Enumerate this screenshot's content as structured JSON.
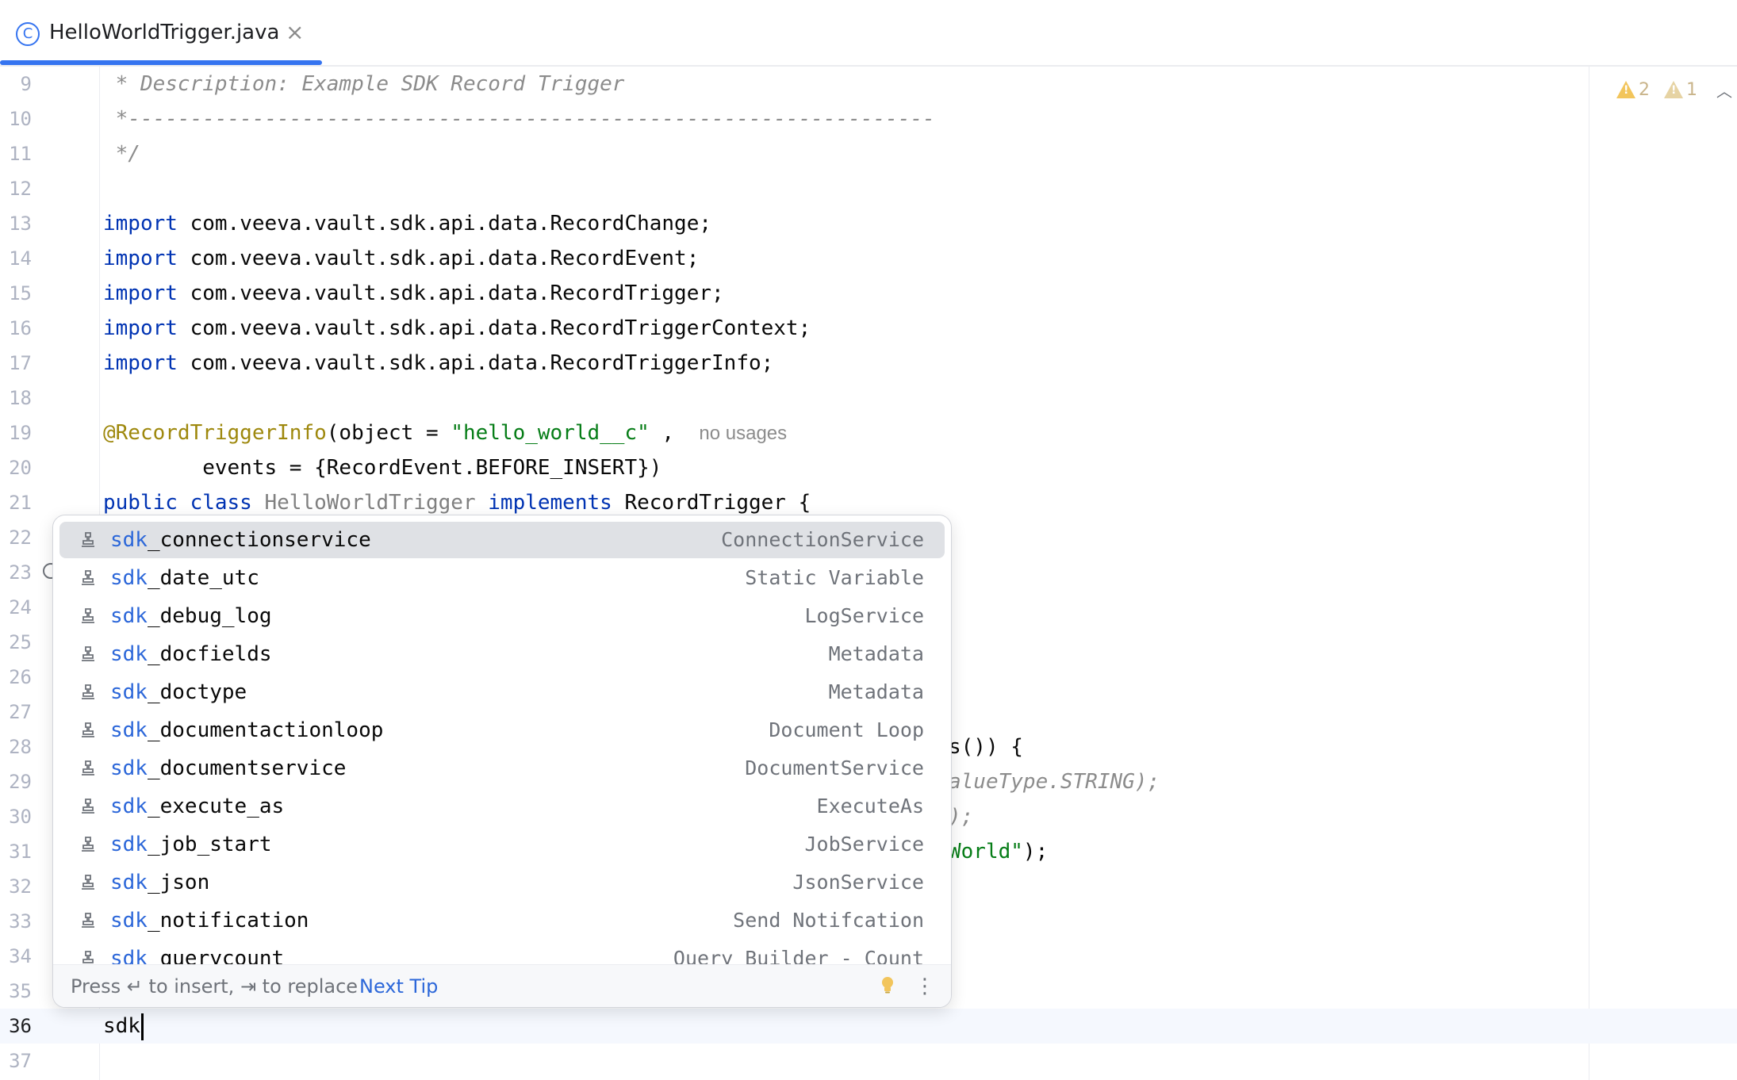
{
  "tab": {
    "label": "HelloWorldTrigger.java",
    "icon": "class-icon",
    "icon_glyph": "C",
    "close_glyph": "×"
  },
  "inspections": {
    "warnings": "2",
    "weak_warnings": "1"
  },
  "lines": {
    "l9": {
      "num": "9",
      "text": " * Description: Example SDK Record Trigger"
    },
    "l10": {
      "num": "10",
      "text": " *-----------------------------------------------------------------"
    },
    "l11": {
      "num": "11",
      "text": " */"
    },
    "l12": {
      "num": "12"
    },
    "l13": {
      "num": "13",
      "kw": "import",
      "rest": " com.veeva.vault.sdk.api.data.RecordChange;"
    },
    "l14": {
      "num": "14",
      "kw": "import",
      "rest": " com.veeva.vault.sdk.api.data.RecordEvent;"
    },
    "l15": {
      "num": "15",
      "kw": "import",
      "rest": " com.veeva.vault.sdk.api.data.RecordTrigger;"
    },
    "l16": {
      "num": "16",
      "kw": "import",
      "rest": " com.veeva.vault.sdk.api.data.RecordTriggerContext;"
    },
    "l17": {
      "num": "17",
      "kw": "import",
      "rest": " com.veeva.vault.sdk.api.data.RecordTriggerInfo;"
    },
    "l18": {
      "num": "18"
    },
    "l19": {
      "num": "19",
      "ann": "@RecordTriggerInfo",
      "mid": "(object = ",
      "str": "\"hello_world__c\"",
      "tail": " ,  ",
      "hint": "no usages"
    },
    "l20": {
      "num": "20",
      "text": "        events = {RecordEvent.BEFORE_INSERT})"
    },
    "l21": {
      "num": "21",
      "kw1": "public class",
      "cls": " HelloWorldTrigger",
      "kw2": " implements",
      "rest": " RecordTrigger {"
    },
    "l22": {
      "num": "22"
    },
    "l23": {
      "num": "23"
    },
    "l24": {
      "num": "24"
    },
    "l25": {
      "num": "25"
    },
    "l26": {
      "num": "26"
    },
    "l27": {
      "num": "27"
    },
    "l28": {
      "num": "28",
      "frag": "s()) {"
    },
    "l29": {
      "num": "29",
      "frag": "alueType.STRING);"
    },
    "l30": {
      "num": "30",
      "frag": ");"
    },
    "l31": {
      "num": "31",
      "frag_str": "World\"",
      "frag_tail": ");"
    },
    "l32": {
      "num": "32"
    },
    "l33": {
      "num": "33"
    },
    "l34": {
      "num": "34"
    },
    "l35": {
      "num": "35"
    },
    "l36": {
      "num": "36",
      "text": "sdk"
    },
    "l37": {
      "num": "37"
    }
  },
  "completion": {
    "prefix": "sdk",
    "items": [
      {
        "rest": "_connectionservice",
        "type": "ConnectionService"
      },
      {
        "rest": "_date_utc",
        "type": "Static Variable"
      },
      {
        "rest": "_debug_log",
        "type": "LogService"
      },
      {
        "rest": "_docfields",
        "type": "Metadata"
      },
      {
        "rest": "_doctype",
        "type": "Metadata"
      },
      {
        "rest": "_documentactionloop",
        "type": "Document Loop"
      },
      {
        "rest": "_documentservice",
        "type": "DocumentService"
      },
      {
        "rest": "_execute_as",
        "type": "ExecuteAs"
      },
      {
        "rest": "_job_start",
        "type": "JobService"
      },
      {
        "rest": "_json",
        "type": "JsonService"
      },
      {
        "rest": "_notification",
        "type": "Send Notifcation"
      },
      {
        "rest": "_querycount",
        "type": "Query Builder - Count"
      }
    ],
    "footer_hint": "Press ↵ to insert, ⇥ to replace",
    "next_tip": "Next Tip",
    "more_glyph": "⋮"
  },
  "colors": {
    "accent": "#3574f0",
    "keyword": "#0033b3",
    "string": "#067d17",
    "annotation": "#9e880d",
    "comment": "#8c8c8c",
    "match": "#2c67d9"
  }
}
